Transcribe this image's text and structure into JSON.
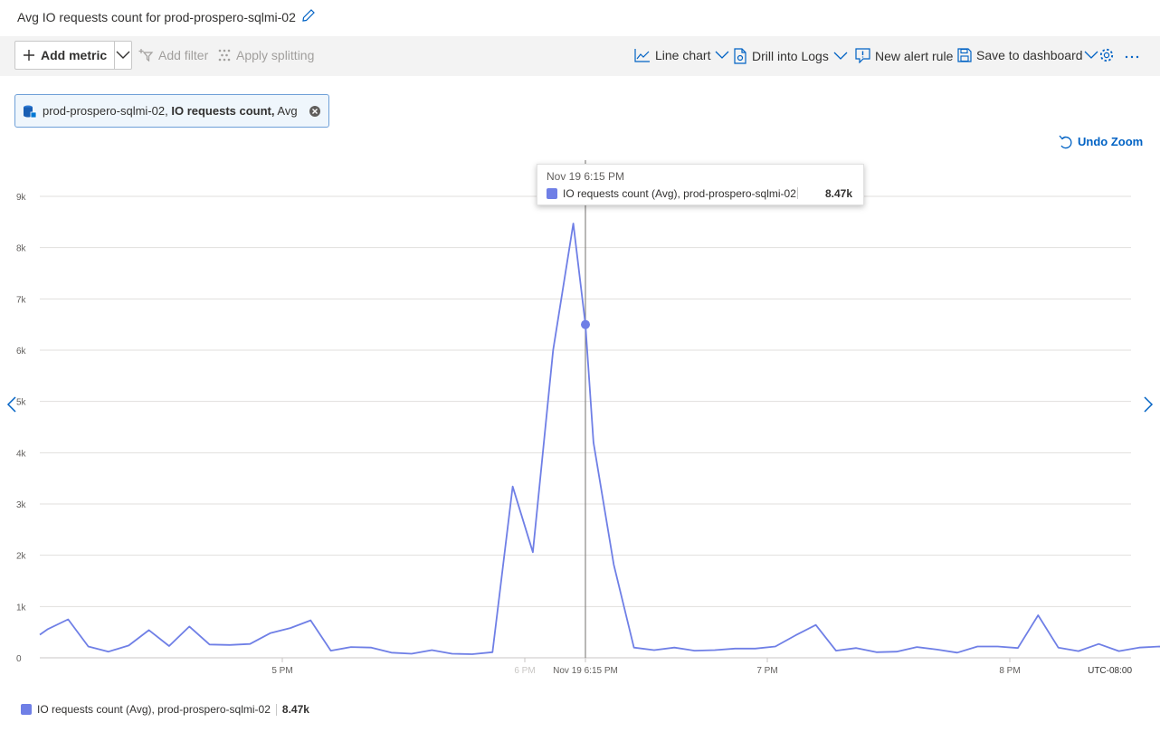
{
  "header": {
    "title": "Avg IO requests count for prod-prospero-sqlmi-02"
  },
  "toolbar": {
    "add_metric": "Add metric",
    "add_filter": "Add filter",
    "apply_splitting": "Apply splitting",
    "line_chart": "Line chart",
    "drill_logs": "Drill into Logs",
    "new_alert": "New alert rule",
    "save_dashboard": "Save to dashboard"
  },
  "chip": {
    "resource": "prod-prospero-sqlmi-02,",
    "metric": "IO requests count,",
    "agg": "Avg"
  },
  "undo_zoom": "Undo Zoom",
  "tooltip": {
    "time": "Nov 19 6:15 PM",
    "series": "IO requests count (Avg), prod-prospero-sqlmi-02",
    "value": "8.47k"
  },
  "legend": {
    "series": "IO requests count (Avg), prod-prospero-sqlmi-02",
    "value": "8.47k"
  },
  "colors": {
    "series": "#6f7fe6",
    "accent": "#0062c4"
  },
  "chart_data": {
    "type": "line",
    "ylim": [
      0,
      9000
    ],
    "y_ticks": [
      0,
      1000,
      2000,
      3000,
      4000,
      5000,
      6000,
      7000,
      8000,
      9000
    ],
    "y_tick_labels": [
      "0",
      "1k",
      "2k",
      "3k",
      "4k",
      "5k",
      "6k",
      "7k",
      "8k",
      "9k"
    ],
    "x_range_minutes": [
      960,
      1230
    ],
    "x_ticks": [
      {
        "minute": 1020,
        "label": "5 PM",
        "faded": false
      },
      {
        "minute": 1080,
        "label": "6 PM",
        "faded": true
      },
      {
        "minute": 1095,
        "label": "Nov 19 6:15 PM",
        "faded": false
      },
      {
        "minute": 1140,
        "label": "7 PM",
        "faded": false
      },
      {
        "minute": 1200,
        "label": "8 PM",
        "faded": false
      }
    ],
    "timezone_label": "UTC-08:00",
    "hover_minute": 1095,
    "series": [
      {
        "x": [
          960,
          962,
          967,
          972,
          977,
          982,
          987,
          992,
          997,
          1002,
          1007,
          1012,
          1017,
          1022,
          1027,
          1032,
          1037,
          1042,
          1047,
          1052,
          1057,
          1062,
          1067,
          1072,
          1077,
          1082,
          1087,
          1092,
          1095,
          1097,
          1102,
          1107,
          1112,
          1117,
          1122,
          1127,
          1132,
          1137,
          1142,
          1147,
          1152,
          1157,
          1162,
          1167,
          1172,
          1177,
          1182,
          1187,
          1192,
          1197,
          1202,
          1207,
          1212,
          1217,
          1222,
          1227,
          1232,
          1237,
          1242,
          1247,
          1249
        ],
        "values": [
          450,
          560,
          750,
          220,
          120,
          240,
          540,
          230,
          610,
          260,
          250,
          270,
          480,
          580,
          730,
          140,
          210,
          200,
          100,
          80,
          150,
          80,
          70,
          110,
          3340,
          2060,
          6000,
          8470,
          6500,
          4200,
          1820,
          200,
          150,
          200,
          140,
          150,
          180,
          180,
          220,
          440,
          640,
          140,
          190,
          110,
          120,
          210,
          160,
          100,
          220,
          220,
          190,
          830,
          200,
          130,
          270,
          130,
          200,
          220,
          170,
          130,
          220
        ]
      }
    ]
  }
}
